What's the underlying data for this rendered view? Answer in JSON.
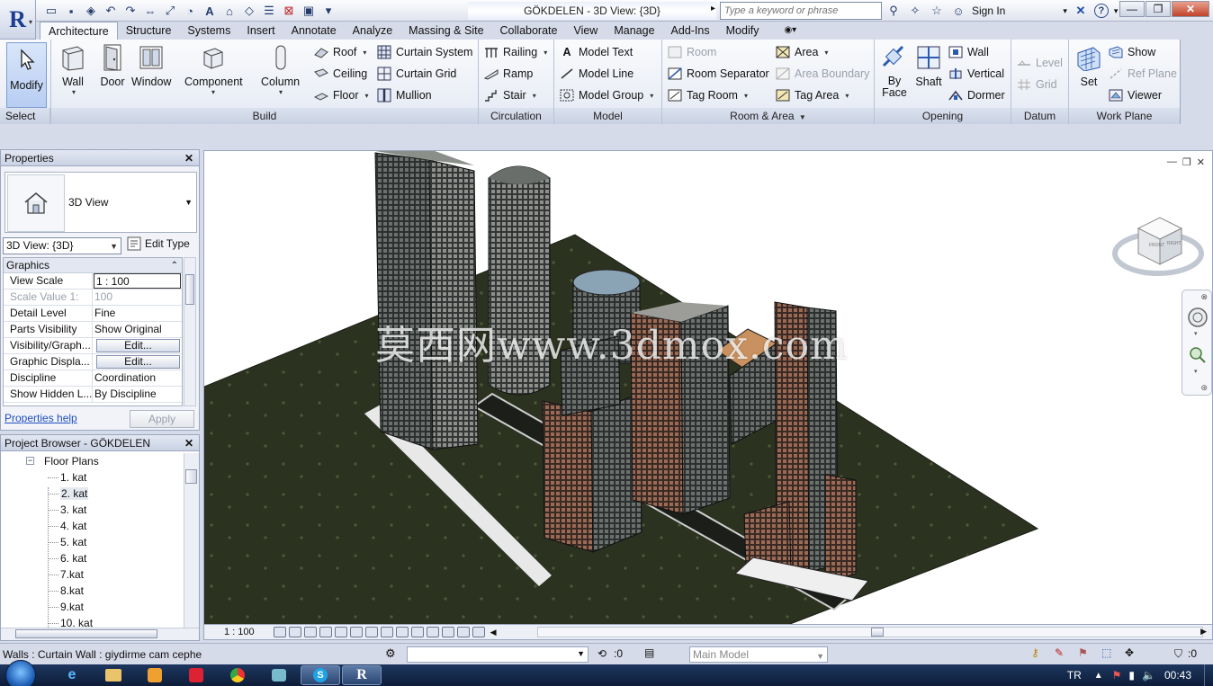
{
  "app": {
    "logo_letter": "R",
    "title": "GÖKDELEN - 3D View: {3D}",
    "search_placeholder": "Type a keyword or phrase",
    "sign_in": "Sign In"
  },
  "tabs": [
    "Architecture",
    "Structure",
    "Systems",
    "Insert",
    "Annotate",
    "Analyze",
    "Massing & Site",
    "Collaborate",
    "View",
    "Manage",
    "Add-Ins",
    "Modify"
  ],
  "active_tab": "Architecture",
  "ribbon": {
    "select": {
      "modify": "Modify",
      "title": "Select"
    },
    "build": {
      "title": "Build",
      "wall": "Wall",
      "door": "Door",
      "window": "Window",
      "component": "Component",
      "column": "Column",
      "roof": "Roof",
      "ceiling": "Ceiling",
      "floor": "Floor",
      "curtain_system": "Curtain System",
      "curtain_grid": "Curtain Grid",
      "mullion": "Mullion"
    },
    "circulation": {
      "title": "Circulation",
      "railing": "Railing",
      "ramp": "Ramp",
      "stair": "Stair"
    },
    "model": {
      "title": "Model",
      "model_text": "Model Text",
      "model_line": "Model Line",
      "model_group": "Model Group"
    },
    "room_area": {
      "title": "Room & Area",
      "room": "Room",
      "room_separator": "Room Separator",
      "tag_room": "Tag Room",
      "area": "Area",
      "area_boundary": "Area Boundary",
      "tag_area": "Tag Area"
    },
    "opening": {
      "title": "Opening",
      "by_face_1": "By",
      "by_face_2": "Face",
      "shaft": "Shaft",
      "wall": "Wall",
      "vertical": "Vertical",
      "dormer": "Dormer"
    },
    "datum": {
      "title": "Datum",
      "level": "Level",
      "grid": "Grid"
    },
    "work_plane": {
      "title": "Work Plane",
      "set": "Set",
      "show": "Show",
      "ref_plane": "Ref Plane",
      "viewer": "Viewer"
    }
  },
  "properties": {
    "title": "Properties",
    "type_name": "3D View",
    "instance": "3D View: {3D}",
    "edit_type": "Edit Type",
    "group": "Graphics",
    "rows": [
      {
        "key": "View Scale",
        "value": "1 : 100"
      },
      {
        "key": "Scale Value    1:",
        "value": "100"
      },
      {
        "key": "Detail Level",
        "value": "Fine"
      },
      {
        "key": "Parts Visibility",
        "value": "Show Original"
      },
      {
        "key": "Visibility/Graph...",
        "value": "Edit..."
      },
      {
        "key": "Graphic Displa...",
        "value": "Edit..."
      },
      {
        "key": "Discipline",
        "value": "Coordination"
      },
      {
        "key": "Show Hidden L...",
        "value": "By Discipline"
      }
    ],
    "help": "Properties help",
    "apply": "Apply"
  },
  "browser": {
    "title": "Project Browser - GÖKDELEN",
    "root": "Floor Plans",
    "items": [
      "1. kat",
      "2. kat",
      "3. kat",
      "4. kat",
      "5. kat",
      "6. kat",
      "7.kat",
      "8.kat",
      "9.kat",
      "10. kat"
    ],
    "selected_index": 1
  },
  "viewport": {
    "watermark": "莫西网www.3dmox.com",
    "cube_front": "FRONT",
    "cube_right": "RIGHT"
  },
  "viewbar": {
    "scale": "1 : 100"
  },
  "status": {
    "text": "Walls : Curtain Wall : giydirme cam cephe",
    "count": ":0",
    "model": "Main Model",
    "filter": ":0"
  },
  "taskbar": {
    "lang": "TR",
    "time": "00:43"
  },
  "colors": {
    "accent": "#1b3e91",
    "ground": "#2b3120",
    "tower": "#3b3f3e"
  }
}
